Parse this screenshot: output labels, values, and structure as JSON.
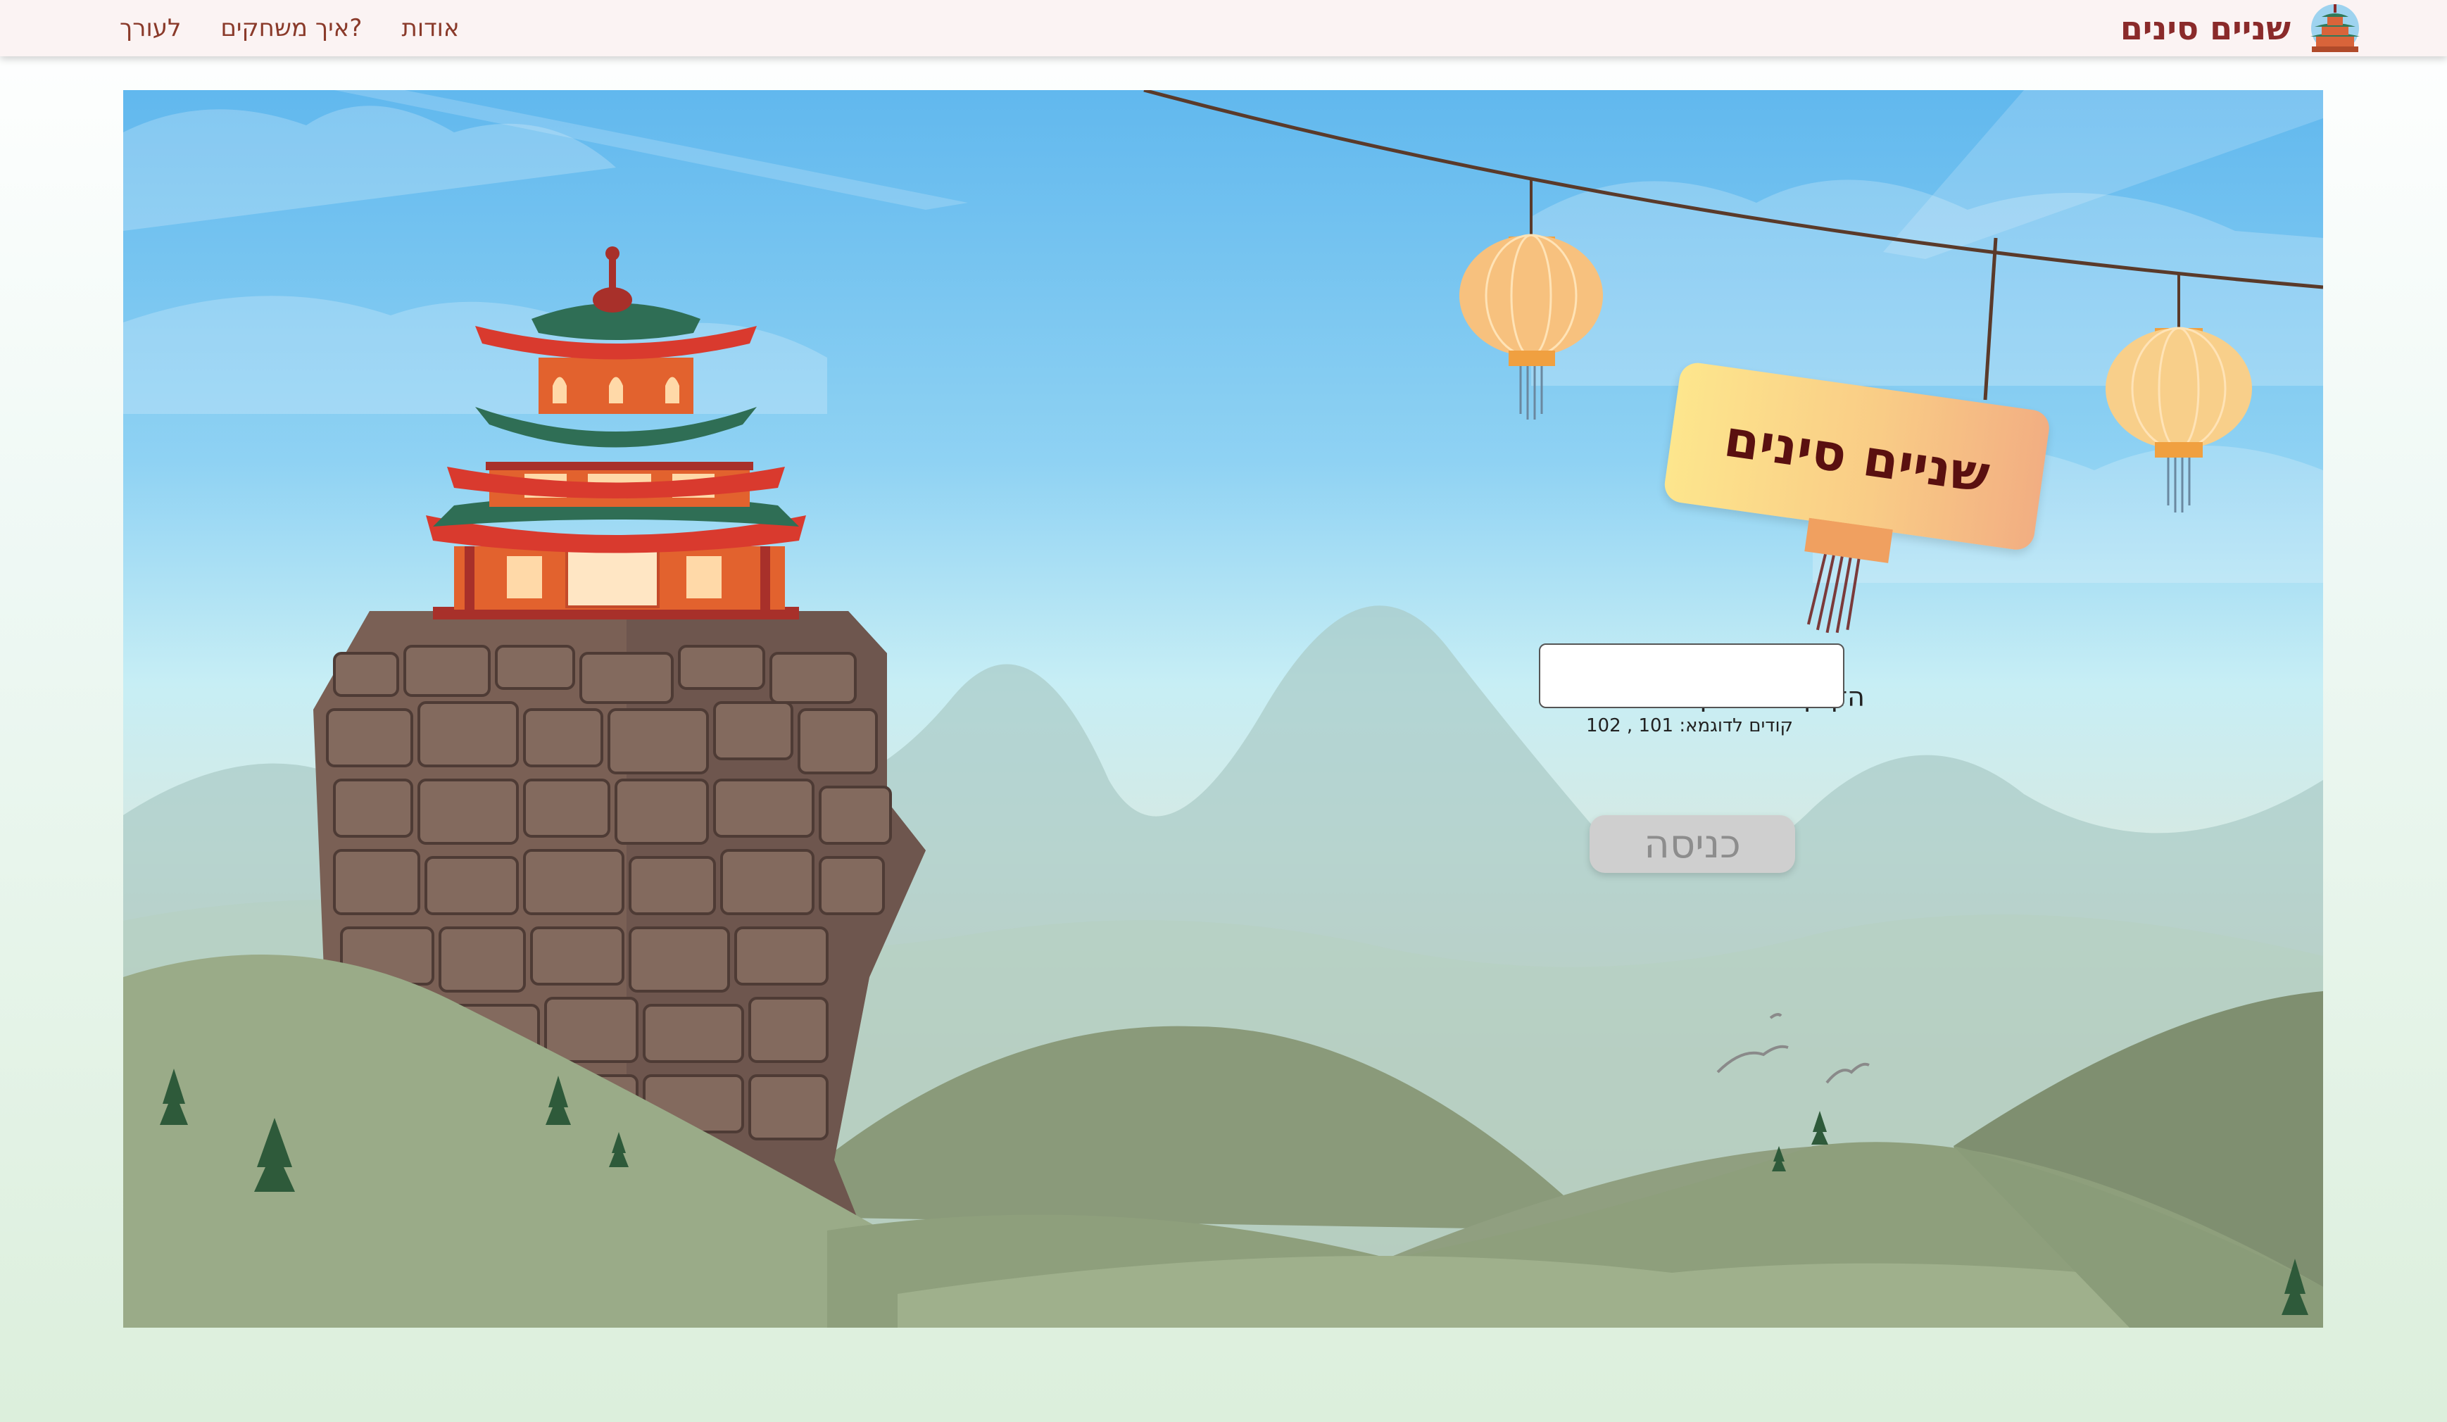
{
  "header": {
    "title": "שניים סינים",
    "logo_icon": "pagoda-logo-icon",
    "nav": [
      {
        "label": "לעורך"
      },
      {
        "label": "איך משחקים?"
      },
      {
        "label": "אודות"
      }
    ]
  },
  "scene": {
    "sign_text": "שניים סינים",
    "code_label": "הזן קוד משחק:",
    "code_value": "",
    "code_hint": "קודים לדוגמא: 101 , 102",
    "enter_label": "כניסה"
  },
  "colors": {
    "accent": "#8a2a2a",
    "topbar": "#fbf3f3",
    "button_disabled": "#cfcfcf"
  }
}
